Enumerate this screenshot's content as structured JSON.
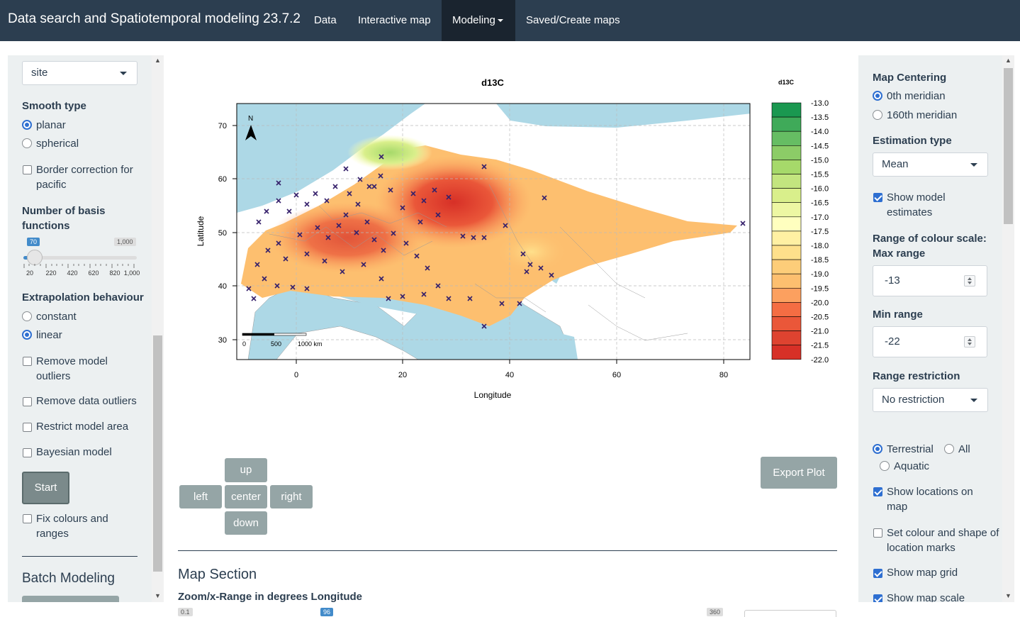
{
  "navbar": {
    "brand": "Data search and Spatiotemporal modeling 23.7.2",
    "items": [
      {
        "label": "Data"
      },
      {
        "label": "Interactive map"
      },
      {
        "label": "Modeling",
        "active": true
      },
      {
        "label": "Saved/Create maps"
      }
    ]
  },
  "left_panel": {
    "site_select": "site",
    "smooth_type": {
      "label": "Smooth type",
      "options": [
        "planar",
        "spherical"
      ],
      "selected": "planar"
    },
    "border_correction": {
      "label": "Border correction for pacific",
      "checked": false
    },
    "basis_functions": {
      "label": "Number of basis functions",
      "value": "70",
      "max_label": "1,000",
      "ticks": [
        "20",
        "220",
        "420",
        "620",
        "820",
        "1,000"
      ]
    },
    "extrapolation": {
      "label": "Extrapolation behaviour",
      "options": [
        "constant",
        "linear"
      ],
      "selected": "linear"
    },
    "checkboxes": [
      {
        "label": "Remove model outliers",
        "checked": false
      },
      {
        "label": "Remove data outliers",
        "checked": false
      },
      {
        "label": "Restrict model area",
        "checked": false
      },
      {
        "label": "Bayesian model",
        "checked": false
      }
    ],
    "start_button": "Start",
    "fix_colours": {
      "label": "Fix colours and ranges",
      "checked": false
    },
    "batch_title": "Batch Modeling"
  },
  "plot": {
    "title": "d13C",
    "xlabel": "Longitude",
    "ylabel": "Latitude",
    "x_ticks": [
      "0",
      "20",
      "40",
      "60",
      "80"
    ],
    "y_ticks": [
      "30",
      "40",
      "50",
      "60",
      "70"
    ],
    "legend_title": "d13C",
    "legend_values": [
      "-13.0",
      "-13.5",
      "-14.0",
      "-14.5",
      "-15.0",
      "-15.5",
      "-16.0",
      "-16.5",
      "-17.0",
      "-17.5",
      "-18.0",
      "-18.5",
      "-19.0",
      "-19.5",
      "-20.0",
      "-20.5",
      "-21.0",
      "-21.5",
      "-22.0"
    ],
    "legend_colors": [
      "#1a9850",
      "#3faa59",
      "#66bd63",
      "#8ccc67",
      "#a6d96a",
      "#c3e57f",
      "#d9ef8b",
      "#edf7a3",
      "#ffffbf",
      "#fff0a3",
      "#fee08b",
      "#fdcd79",
      "#fdbf6f",
      "#fca05f",
      "#f46d43",
      "#ea5739",
      "#de4330",
      "#d73027",
      "#d73027"
    ],
    "scalebar": [
      "0",
      "500",
      "1000 km"
    ],
    "north": "N"
  },
  "nav_buttons": {
    "up": "up",
    "left": "left",
    "center": "center",
    "right": "right",
    "down": "down"
  },
  "export_button": "Export Plot",
  "map_section": {
    "title": "Map Section",
    "zoom_label": "Zoom/x-Range in degrees Longitude",
    "zoom_min": "0.1",
    "zoom_value": "96",
    "zoom_max": "360"
  },
  "right_panel": {
    "map_centering": {
      "label": "Map Centering",
      "options": [
        "0th meridian",
        "160th meridian"
      ],
      "selected": "0th meridian"
    },
    "estimation_type": {
      "label": "Estimation type",
      "value": "Mean"
    },
    "show_model_estimates": {
      "label": "Show model estimates",
      "checked": true
    },
    "max_range": {
      "label": "Range of colour scale: Max range",
      "value": "-13"
    },
    "min_range": {
      "label": "Min range",
      "value": "-22"
    },
    "range_restriction": {
      "label": "Range restriction",
      "value": "No restriction"
    },
    "habitat": {
      "options": [
        "Terrestrial",
        "All",
        "Aquatic"
      ],
      "selected": "Terrestrial"
    },
    "show_locations": {
      "label": "Show locations on map",
      "checked": true
    },
    "set_colour_shape": {
      "label": "Set colour and shape of location marks",
      "checked": false
    },
    "show_grid": {
      "label": "Show map grid",
      "checked": true
    },
    "show_scale": {
      "label": "Show map scale",
      "checked": true
    }
  }
}
